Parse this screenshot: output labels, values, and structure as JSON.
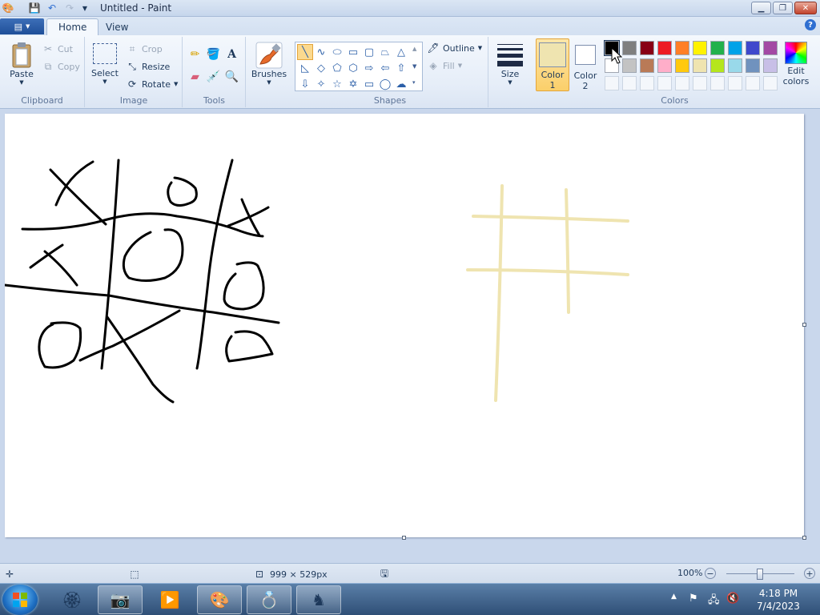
{
  "window": {
    "title": "Untitled - Paint"
  },
  "tabs": {
    "home": "Home",
    "view": "View"
  },
  "clipboard": {
    "paste": "Paste",
    "cut": "Cut",
    "copy": "Copy",
    "group": "Clipboard"
  },
  "image": {
    "select": "Select",
    "crop": "Crop",
    "resize": "Resize",
    "rotate": "Rotate",
    "group": "Image"
  },
  "tools": {
    "group": "Tools",
    "brushes": "Brushes"
  },
  "shapes": {
    "outline": "Outline",
    "fill": "Fill",
    "group": "Shapes"
  },
  "size": {
    "label": "Size"
  },
  "colors": {
    "color1_line1": "Color",
    "color1_line2": "1",
    "color2_line1": "Color",
    "color2_line2": "2",
    "edit_line1": "Edit",
    "edit_line2": "colors",
    "group": "Colors",
    "color1_value": "#efe4b0",
    "color2_value": "#ffffff",
    "palette_row1": [
      "#000000",
      "#7f7f7f",
      "#880015",
      "#ed1c24",
      "#ff7f27",
      "#fff200",
      "#22b14c",
      "#00a2e8",
      "#3f48cc",
      "#a349a4"
    ],
    "palette_row2": [
      "#ffffff",
      "#c3c3c3",
      "#b97a57",
      "#ffaec9",
      "#ffc90e",
      "#efe4b0",
      "#b5e61d",
      "#99d9ea",
      "#7092be",
      "#c8bfe7"
    ]
  },
  "statusbar": {
    "canvas_size": "999 × 529px",
    "zoom": "100%"
  },
  "taskbar": {
    "time": "4:18 PM",
    "date": "7/4/2023"
  }
}
